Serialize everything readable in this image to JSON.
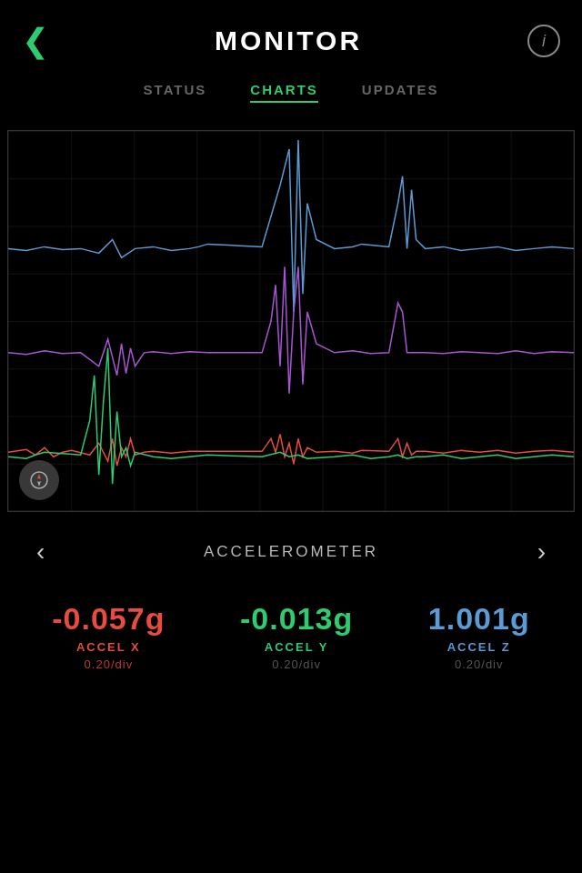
{
  "header": {
    "back_icon": "‹",
    "title": "MONITOR",
    "info_icon": "i"
  },
  "tabs": [
    {
      "id": "status",
      "label": "STATUS",
      "state": "inactive"
    },
    {
      "id": "charts",
      "label": "CHARTS",
      "state": "active"
    },
    {
      "id": "updates",
      "label": "UPDATES",
      "state": "inactive"
    }
  ],
  "chart": {
    "grid_color": "#222",
    "lines": [
      {
        "id": "accel_z",
        "color": "#5b9bd5"
      },
      {
        "id": "accel_y",
        "color": "#a855d4"
      },
      {
        "id": "accel_x",
        "color": "#e74c3c"
      },
      {
        "id": "accel_g",
        "color": "#2ecc71"
      }
    ]
  },
  "nav": {
    "prev_icon": "‹",
    "label": "ACCELEROMETER",
    "next_icon": "›"
  },
  "values": [
    {
      "id": "accel_x",
      "number": "-0.057g",
      "label": "ACCEL X",
      "div": "0.20/div",
      "color_class": "red",
      "label_color": "red",
      "div_color": "red-dim"
    },
    {
      "id": "accel_y",
      "number": "-0.013g",
      "label": "ACCEL Y",
      "div": "0.20/div",
      "color_class": "green",
      "label_color": "green",
      "div_color": "grey-dim"
    },
    {
      "id": "accel_z",
      "number": "1.001g",
      "label": "ACCEL Z",
      "div": "0.20/div",
      "color_class": "blue",
      "label_color": "blue",
      "div_color": "grey-dim"
    }
  ]
}
